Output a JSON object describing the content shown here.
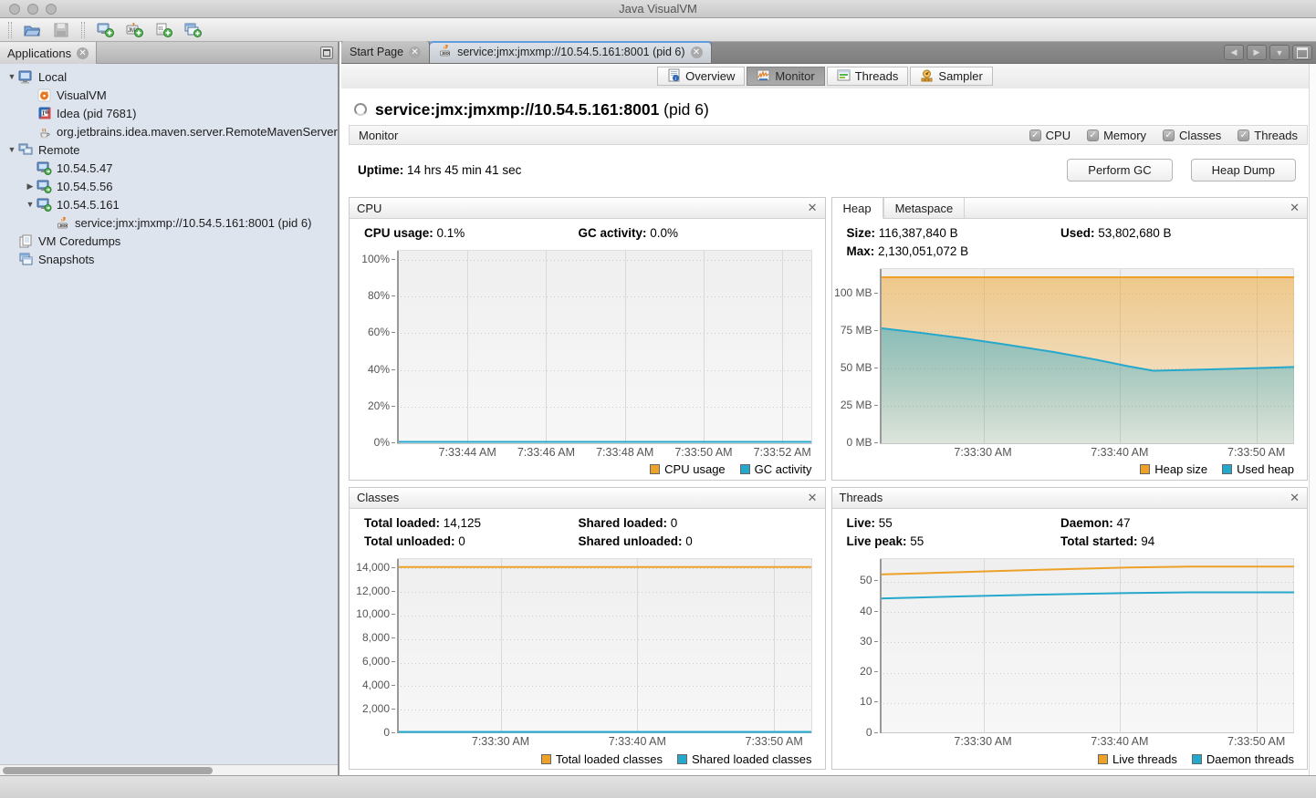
{
  "window": {
    "title": "Java VisualVM"
  },
  "toolbar": {
    "icons": [
      "load-snapshot",
      "save-snapshot",
      "add-remote-host",
      "add-jmx-connection",
      "add-vm-coredump",
      "add-snapshot"
    ]
  },
  "sidebar": {
    "header": {
      "tab_label": "Applications"
    },
    "tree": [
      {
        "label": "Local",
        "icon": "local-computer",
        "level": 0,
        "expander": "open"
      },
      {
        "label": "VisualVM",
        "icon": "visualvm",
        "level": 1,
        "expander": "none"
      },
      {
        "label": "Idea (pid 7681)",
        "icon": "idea",
        "level": 1,
        "expander": "none"
      },
      {
        "label": "org.jetbrains.idea.maven.server.RemoteMavenServer",
        "icon": "java-app",
        "level": 1,
        "expander": "none"
      },
      {
        "label": "Remote",
        "icon": "remote",
        "level": 0,
        "expander": "open"
      },
      {
        "label": "10.54.5.47",
        "icon": "host",
        "level": 1,
        "expander": "none"
      },
      {
        "label": "10.54.5.56",
        "icon": "host",
        "level": 1,
        "expander": "closed"
      },
      {
        "label": "10.54.5.161",
        "icon": "host",
        "level": 1,
        "expander": "open"
      },
      {
        "label": "service:jmx:jmxmp://10.54.5.161:8001 (pid 6)",
        "icon": "jmx",
        "level": 2,
        "expander": "none"
      },
      {
        "label": "VM Coredumps",
        "icon": "coredumps",
        "level": 0,
        "expander": "none"
      },
      {
        "label": "Snapshots",
        "icon": "snapshots",
        "level": 0,
        "expander": "none"
      }
    ]
  },
  "tabs": {
    "start_page": "Start Page",
    "session": "service:jmx:jmxmp://10.54.5.161:8001 (pid 6)"
  },
  "subtabs": [
    {
      "label": "Overview",
      "icon": "overview-icon",
      "selected": false
    },
    {
      "label": "Monitor",
      "icon": "monitor-icon",
      "selected": true
    },
    {
      "label": "Threads",
      "icon": "threads-icon",
      "selected": false
    },
    {
      "label": "Sampler",
      "icon": "sampler-icon",
      "selected": false
    }
  ],
  "header": {
    "title_bold": "service:jmx:jmxmp://10.54.5.161:8001",
    "title_suffix": " (pid 6)"
  },
  "monitor_bar": {
    "label": "Monitor",
    "checkboxes": [
      "CPU",
      "Memory",
      "Classes",
      "Threads"
    ]
  },
  "uptime": {
    "label": "Uptime:",
    "value": "14 hrs 45 min 41 sec"
  },
  "buttons": {
    "perform_gc": "Perform GC",
    "heap_dump": "Heap Dump"
  },
  "panels": {
    "cpu": {
      "title": "CPU",
      "stats": [
        [
          [
            "CPU usage:",
            "0.1%"
          ],
          [
            "GC activity:",
            "0.0%"
          ]
        ]
      ]
    },
    "heap": {
      "tabs": [
        "Heap",
        "Metaspace"
      ],
      "active_tab": "Heap",
      "stats": [
        [
          [
            "Size:",
            "116,387,840 B"
          ],
          [
            "Used:",
            "53,802,680 B"
          ]
        ],
        [
          [
            "Max:",
            "2,130,051,072 B"
          ]
        ]
      ]
    },
    "classes": {
      "title": "Classes",
      "stats": [
        [
          [
            "Total loaded:",
            "14,125"
          ],
          [
            "Shared loaded:",
            "0"
          ]
        ],
        [
          [
            "Total unloaded:",
            "0"
          ],
          [
            "Shared unloaded:",
            "0"
          ]
        ]
      ]
    },
    "threads": {
      "title": "Threads",
      "stats": [
        [
          [
            "Live:",
            "55"
          ],
          [
            "Daemon:",
            "47"
          ]
        ],
        [
          [
            "Live peak:",
            "55"
          ],
          [
            "Total started:",
            "94"
          ]
        ]
      ]
    }
  },
  "colors": {
    "accent_orange": "#EDA128",
    "accent_blue": "#25A8CC",
    "tab_highlight": "#5F9DDF"
  },
  "chart_data": [
    {
      "id": "cpu",
      "type": "line",
      "title": "CPU",
      "xlabel": "",
      "ylabel": "",
      "grid": true,
      "legend_position": "bottom-right",
      "ymax": 105,
      "y_ticks": [
        {
          "label": "100%",
          "v": 100
        },
        {
          "label": "80%",
          "v": 80
        },
        {
          "label": "60%",
          "v": 60
        },
        {
          "label": "40%",
          "v": 40
        },
        {
          "label": "20%",
          "v": 20
        },
        {
          "label": "0%",
          "v": 0
        }
      ],
      "x_ticks": [
        {
          "label": "7:33:44 AM",
          "fx": 0.17
        },
        {
          "label": "7:33:46 AM",
          "fx": 0.36
        },
        {
          "label": "7:33:48 AM",
          "fx": 0.55
        },
        {
          "label": "7:33:50 AM",
          "fx": 0.74
        },
        {
          "label": "7:33:52 AM",
          "fx": 0.93
        }
      ],
      "series": [
        {
          "name": "CPU usage",
          "color": "#EDA128",
          "fill": false,
          "points": [
            [
              0,
              0.1
            ],
            [
              1,
              0.1
            ]
          ]
        },
        {
          "name": "GC activity",
          "color": "#25A8CC",
          "fill": false,
          "points": [
            [
              0,
              0
            ],
            [
              1,
              0
            ]
          ]
        }
      ]
    },
    {
      "id": "heap",
      "type": "area",
      "title": "Heap",
      "xlabel": "",
      "ylabel": "MB",
      "grid": true,
      "legend_position": "bottom-right",
      "ymax": 116.5,
      "y_ticks": [
        {
          "label": "100 MB",
          "v": 100
        },
        {
          "label": "75 MB",
          "v": 75
        },
        {
          "label": "50 MB",
          "v": 50
        },
        {
          "label": "25 MB",
          "v": 25
        },
        {
          "label": "0 MB",
          "v": 0
        }
      ],
      "x_ticks": [
        {
          "label": "7:33:30 AM",
          "fx": 0.25
        },
        {
          "label": "7:33:40 AM",
          "fx": 0.58
        },
        {
          "label": "7:33:50 AM",
          "fx": 0.91
        }
      ],
      "series": [
        {
          "name": "Heap size",
          "color": "#EDA128",
          "fill": true,
          "points": [
            [
              0,
              111
            ],
            [
              1,
              111
            ]
          ]
        },
        {
          "name": "Used heap",
          "color": "#25A8CC",
          "fill": true,
          "points": [
            [
              0,
              77
            ],
            [
              0.1,
              73.8
            ],
            [
              0.2,
              70.2
            ],
            [
              0.3,
              66.2
            ],
            [
              0.42,
              61
            ],
            [
              0.52,
              56
            ],
            [
              0.6,
              51.5
            ],
            [
              0.66,
              48.5
            ],
            [
              0.78,
              49.3
            ],
            [
              0.9,
              50.2
            ],
            [
              1,
              51
            ]
          ]
        }
      ]
    },
    {
      "id": "classes",
      "type": "line",
      "title": "Classes",
      "xlabel": "",
      "ylabel": "",
      "grid": true,
      "legend_position": "bottom-right",
      "ymax": 14800,
      "y_ticks": [
        {
          "label": "14,000",
          "v": 14000
        },
        {
          "label": "12,000",
          "v": 12000
        },
        {
          "label": "10,000",
          "v": 10000
        },
        {
          "label": "8,000",
          "v": 8000
        },
        {
          "label": "6,000",
          "v": 6000
        },
        {
          "label": "4,000",
          "v": 4000
        },
        {
          "label": "2,000",
          "v": 2000
        },
        {
          "label": "0",
          "v": 0
        }
      ],
      "x_ticks": [
        {
          "label": "7:33:30 AM",
          "fx": 0.25
        },
        {
          "label": "7:33:40 AM",
          "fx": 0.58
        },
        {
          "label": "7:33:50 AM",
          "fx": 0.91
        }
      ],
      "series": [
        {
          "name": "Total loaded classes",
          "color": "#EDA128",
          "fill": false,
          "points": [
            [
              0,
              14125
            ],
            [
              1,
              14125
            ]
          ]
        },
        {
          "name": "Shared loaded classes",
          "color": "#25A8CC",
          "fill": true,
          "points": [
            [
              0,
              90
            ],
            [
              1,
              90
            ]
          ]
        }
      ]
    },
    {
      "id": "threads",
      "type": "line",
      "title": "Threads",
      "xlabel": "",
      "ylabel": "",
      "grid": true,
      "legend_position": "bottom-right",
      "ymax": 57.5,
      "y_ticks": [
        {
          "label": "50",
          "v": 50
        },
        {
          "label": "40",
          "v": 40
        },
        {
          "label": "30",
          "v": 30
        },
        {
          "label": "20",
          "v": 20
        },
        {
          "label": "10",
          "v": 10
        },
        {
          "label": "0",
          "v": 0
        }
      ],
      "x_ticks": [
        {
          "label": "7:33:30 AM",
          "fx": 0.25
        },
        {
          "label": "7:33:40 AM",
          "fx": 0.58
        },
        {
          "label": "7:33:50 AM",
          "fx": 0.91
        }
      ],
      "series": [
        {
          "name": "Live threads",
          "color": "#EDA128",
          "fill": false,
          "points": [
            [
              0,
              52.4
            ],
            [
              0.2,
              53.2
            ],
            [
              0.4,
              54
            ],
            [
              0.6,
              54.7
            ],
            [
              0.75,
              55
            ],
            [
              1,
              55
            ]
          ]
        },
        {
          "name": "Daemon threads",
          "color": "#25A8CC",
          "fill": false,
          "points": [
            [
              0,
              44.5
            ],
            [
              0.2,
              45.2
            ],
            [
              0.4,
              45.8
            ],
            [
              0.6,
              46.3
            ],
            [
              0.75,
              46.5
            ],
            [
              1,
              46.5
            ]
          ]
        }
      ]
    }
  ]
}
